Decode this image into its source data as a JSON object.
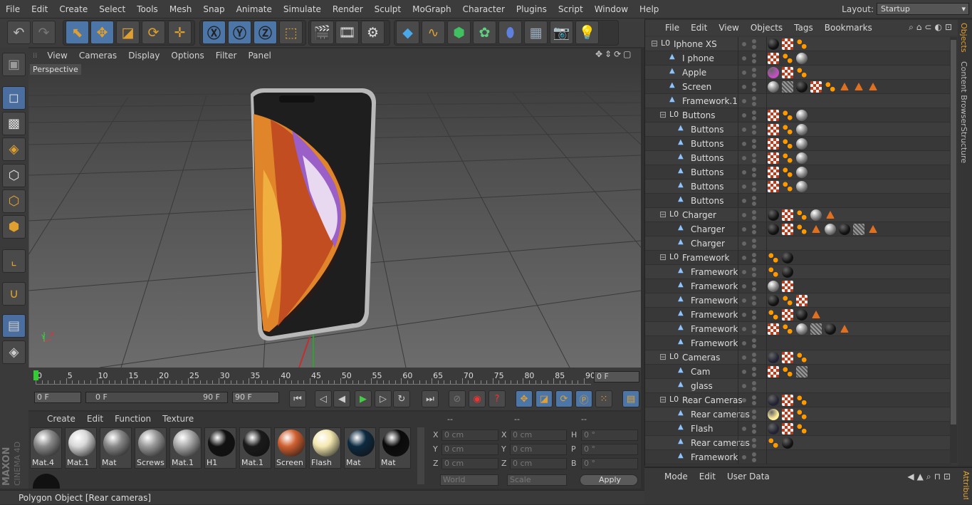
{
  "menubar": {
    "items": [
      "File",
      "Edit",
      "Create",
      "Select",
      "Tools",
      "Mesh",
      "Snap",
      "Animate",
      "Simulate",
      "Render",
      "Sculpt",
      "MoGraph",
      "Character",
      "Plugins",
      "Script",
      "Window",
      "Help"
    ]
  },
  "layout": {
    "label": "Layout:",
    "value": "Startup"
  },
  "viewport": {
    "menu": [
      "View",
      "Cameras",
      "Display",
      "Options",
      "Filter",
      "Panel"
    ],
    "label": "Perspective"
  },
  "timeline": {
    "ticks": [
      "0",
      "5",
      "10",
      "15",
      "20",
      "25",
      "30",
      "35",
      "40",
      "45",
      "50",
      "55",
      "60",
      "65",
      "70",
      "75",
      "80",
      "85",
      "90"
    ],
    "end_field": "0 F",
    "start": "0 F",
    "range_start": "0 F",
    "range_end": "90 F",
    "end": "90 F"
  },
  "materials": {
    "menu": [
      "Create",
      "Edit",
      "Function",
      "Texture"
    ],
    "items": [
      {
        "label": "Mat.4",
        "color": "#8a8a8a"
      },
      {
        "label": "Mat.1",
        "color": "#d8d8d8"
      },
      {
        "label": "Mat",
        "color": "#888"
      },
      {
        "label": "Screws",
        "color": "#9a9a9a"
      },
      {
        "label": "Mat.1",
        "color": "#aaa"
      },
      {
        "label": "H1",
        "color": "#111"
      },
      {
        "label": "Mat.1",
        "color": "#1a1a1a"
      },
      {
        "label": "Screen",
        "color": "#d06030"
      },
      {
        "label": "Flash",
        "color": "#f4e8b0"
      },
      {
        "label": "Mat",
        "color": "#0d2a40"
      },
      {
        "label": "Mat",
        "color": "#0a0a0a"
      }
    ]
  },
  "attributes": {
    "headers": [
      "--",
      "--",
      "--"
    ],
    "labels": [
      "X",
      "Y",
      "Z",
      "X",
      "Y",
      "Z",
      "H",
      "P",
      "B"
    ],
    "values": [
      "0 cm",
      "0 cm",
      "0 cm",
      "0 cm",
      "0 cm",
      "0 cm",
      "0 °",
      "0 °",
      "0 °"
    ],
    "world": "World",
    "scale": "Scale",
    "apply": "Apply"
  },
  "status": "Polygon Object [Rear cameras]",
  "brand": {
    "line1": "MAXON",
    "line2": "CINEMA 4D"
  },
  "objects": {
    "menu": [
      "File",
      "Edit",
      "View",
      "Objects",
      "Tags",
      "Bookmarks"
    ],
    "rows": [
      {
        "name": "Iphone XS",
        "indent": 0,
        "null": true
      },
      {
        "name": "I phone",
        "indent": 1
      },
      {
        "name": "Apple",
        "indent": 1
      },
      {
        "name": "Screen",
        "indent": 1
      },
      {
        "name": "Framework.1",
        "indent": 1
      },
      {
        "name": "Buttons",
        "indent": 1,
        "null": true
      },
      {
        "name": "Buttons",
        "indent": 2
      },
      {
        "name": "Buttons",
        "indent": 2
      },
      {
        "name": "Buttons",
        "indent": 2
      },
      {
        "name": "Buttons",
        "indent": 2
      },
      {
        "name": "Buttons",
        "indent": 2
      },
      {
        "name": "Buttons",
        "indent": 2
      },
      {
        "name": "Charger",
        "indent": 1,
        "null": true
      },
      {
        "name": "Charger",
        "indent": 2
      },
      {
        "name": "Charger",
        "indent": 2
      },
      {
        "name": "Framework",
        "indent": 1,
        "null": true
      },
      {
        "name": "Framework",
        "indent": 2
      },
      {
        "name": "Framework",
        "indent": 2
      },
      {
        "name": "Framework",
        "indent": 2
      },
      {
        "name": "Framework",
        "indent": 2
      },
      {
        "name": "Framework",
        "indent": 2
      },
      {
        "name": "Framework",
        "indent": 2
      },
      {
        "name": "Cameras",
        "indent": 1,
        "null": true
      },
      {
        "name": "Cam",
        "indent": 2
      },
      {
        "name": "glass",
        "indent": 2
      },
      {
        "name": "Rear Cameras",
        "indent": 1,
        "null": true
      },
      {
        "name": "Rear cameras",
        "indent": 2
      },
      {
        "name": "Flash",
        "indent": 2
      },
      {
        "name": "Rear cameras",
        "indent": 2
      },
      {
        "name": "Framework",
        "indent": 2
      }
    ]
  },
  "sidetabs": [
    "Objects",
    "Content Browser",
    "Structure"
  ],
  "attrpanel": {
    "menu": [
      "Mode",
      "Edit",
      "User Data"
    ],
    "sidetab": "Attributes"
  }
}
